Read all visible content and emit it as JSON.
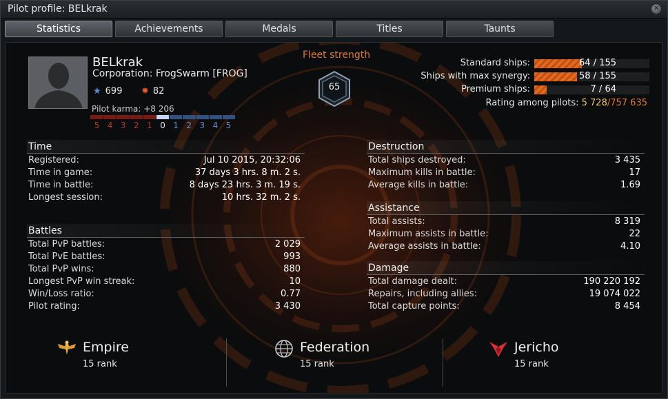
{
  "window": {
    "title": "Pilot profile: BELkrak"
  },
  "tabs": [
    {
      "label": "Statistics",
      "active": true
    },
    {
      "label": "Achievements",
      "active": false
    },
    {
      "label": "Medals",
      "active": false
    },
    {
      "label": "Titles",
      "active": false
    },
    {
      "label": "Taunts",
      "active": false
    }
  ],
  "pilot": {
    "name": "BELkrak",
    "corporation": "Corporation: FrogSwarm [FROG]",
    "stars": "699",
    "kills_icon_value": "82",
    "karma": "Pilot karma: +8 206",
    "karma_scale": [
      "5",
      "4",
      "3",
      "2",
      "1",
      "0",
      "1",
      "2",
      "3",
      "4",
      "5"
    ],
    "colors": {
      "negative": "#8a1f1a",
      "positive": "#3b5d9a",
      "accent": "#e07a3a"
    }
  },
  "fleet": {
    "title": "Fleet strength",
    "value": "65"
  },
  "ships": [
    {
      "label": "Standard ships:",
      "value": "64 / 155",
      "fill": 0.413
    },
    {
      "label": "Ships with max synergy:",
      "value": "58 / 155",
      "fill": 0.374
    },
    {
      "label": "Premium ships:",
      "value": "7 / 64",
      "fill": 0.109
    }
  ],
  "rating": {
    "label": "Rating among pilots:",
    "position": "5 728",
    "total": "757 635"
  },
  "time": {
    "title": "Time",
    "rows": [
      {
        "k": "Registered:",
        "v": "Jul 10 2015, 20:32:06"
      },
      {
        "k": "Time in game:",
        "v": "37 days 3 hrs. 8 m. 2 s."
      },
      {
        "k": "Time in battle:",
        "v": "8 days 23 hrs. 3 m. 19 s."
      },
      {
        "k": "Longest session:",
        "v": "10 hrs. 32 m. 2 s."
      }
    ]
  },
  "battles": {
    "title": "Battles",
    "rows": [
      {
        "k": "Total PvP battles:",
        "v": "2 029"
      },
      {
        "k": "Total PvE battles:",
        "v": "993"
      },
      {
        "k": "Total PvP wins:",
        "v": "880"
      },
      {
        "k": "Longest PvP win streak:",
        "v": "10"
      },
      {
        "k": "Win/Loss ratio:",
        "v": "0.77"
      },
      {
        "k": "Pilot rating:",
        "v": "3 430"
      }
    ]
  },
  "destruction": {
    "title": "Destruction",
    "rows": [
      {
        "k": "Total ships destroyed:",
        "v": "3 435"
      },
      {
        "k": "Maximum kills in battle:",
        "v": "17"
      },
      {
        "k": "Average kills in battle:",
        "v": "1.69"
      }
    ]
  },
  "assistance": {
    "title": "Assistance",
    "rows": [
      {
        "k": "Total assists:",
        "v": "8 319"
      },
      {
        "k": "Maximum assists in battle:",
        "v": "22"
      },
      {
        "k": "Average assists in battle:",
        "v": "4.10"
      }
    ]
  },
  "damage": {
    "title": "Damage",
    "rows": [
      {
        "k": "Total damage dealt:",
        "v": "190 220 192"
      },
      {
        "k": "Repairs, including allies:",
        "v": "19 074 022"
      },
      {
        "k": "Total capture points:",
        "v": "8 454"
      }
    ]
  },
  "factions": [
    {
      "name": "Empire",
      "rank": "15 rank",
      "icon": "empire-eagle-icon"
    },
    {
      "name": "Federation",
      "rank": "15 rank",
      "icon": "federation-globe-icon"
    },
    {
      "name": "Jericho",
      "rank": "15 rank",
      "icon": "jericho-emblem-icon"
    }
  ]
}
